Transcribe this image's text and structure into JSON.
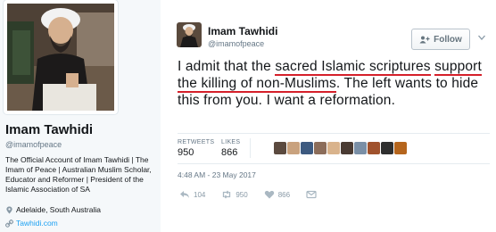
{
  "profile": {
    "name": "Imam Tawhidi",
    "handle": "@imamofpeace",
    "bio": "The Official Account of Imam Tawhidi | The Imam of Peace | Australian Muslim Scholar, Educator and Reformer | President of the Islamic Association of SA",
    "location": "Adelaide, South Australia",
    "website": "Tawhidi.com"
  },
  "tweet": {
    "author_name": "Imam Tawhidi",
    "author_handle": "@imamofpeace",
    "follow_label": "Follow",
    "text_start": "I admit that the ",
    "text_highlight_1": "sacred Islamic scriptures",
    "text_highlight_2": "support the killing of non-Muslims",
    "text_end": ". The left wants to hide this from you. I want a reformation.",
    "retweets_label": "RETWEETS",
    "retweets_count": "950",
    "likes_label": "LIKES",
    "likes_count": "866",
    "timestamp": "4:48 AM - 23 May 2017",
    "reply_count": "104",
    "retweet_action_count": "950",
    "like_action_count": "866"
  },
  "likers_colors": [
    "#5b4a3f",
    "#c9a27e",
    "#3d5a80",
    "#8c6d5a",
    "#d9b38c",
    "#4a3b33",
    "#7a8fa6",
    "#a0522d",
    "#2f2f2f",
    "#b5651d"
  ],
  "colors": {
    "accent": "#1da1f2",
    "highlight_underline": "#d5202a",
    "muted": "#657786"
  }
}
